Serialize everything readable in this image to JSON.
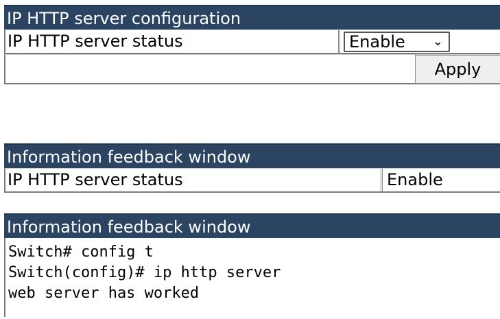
{
  "config_panel": {
    "title": "IP HTTP server configuration",
    "status_label": "IP HTTP server status",
    "status_select_value": "Enable",
    "apply_label": "Apply"
  },
  "feedback_panel_1": {
    "title": "Information feedback window",
    "status_label": "IP HTTP server status",
    "status_value": "Enable"
  },
  "feedback_panel_2": {
    "title": "Information feedback window",
    "console_lines": [
      "Switch# config t",
      "Switch(config)# ip http server",
      "web server has worked"
    ]
  }
}
